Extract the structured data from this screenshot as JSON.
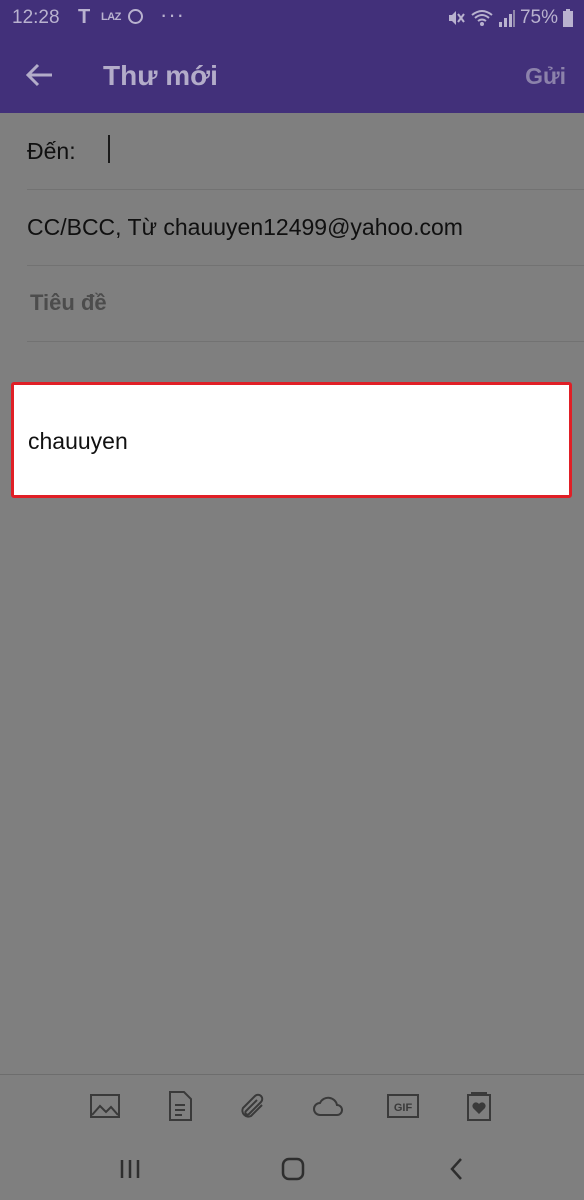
{
  "status_bar": {
    "time": "12:28",
    "notif_t": "T",
    "notif_laz": "LAZ",
    "more_dots": "···",
    "battery": "75%"
  },
  "app_bar": {
    "title": "Thư mới",
    "send_label": "Gửi"
  },
  "compose": {
    "to_label": "Đến:",
    "cc_bcc_from": "CC/BCC, Từ chauuyen12499@yahoo.com",
    "subject_placeholder": "Tiêu đề",
    "body_signature": "chauuyen"
  },
  "toolbar": {
    "icons": [
      "image-icon",
      "document-icon",
      "attachment-icon",
      "cloud-icon",
      "gif-icon",
      "sticker-icon"
    ],
    "gif_text": "GIF"
  },
  "colors": {
    "app_bar": "#42307a",
    "overlay": "#7f7f7f",
    "highlight_border": "#e01f26"
  }
}
